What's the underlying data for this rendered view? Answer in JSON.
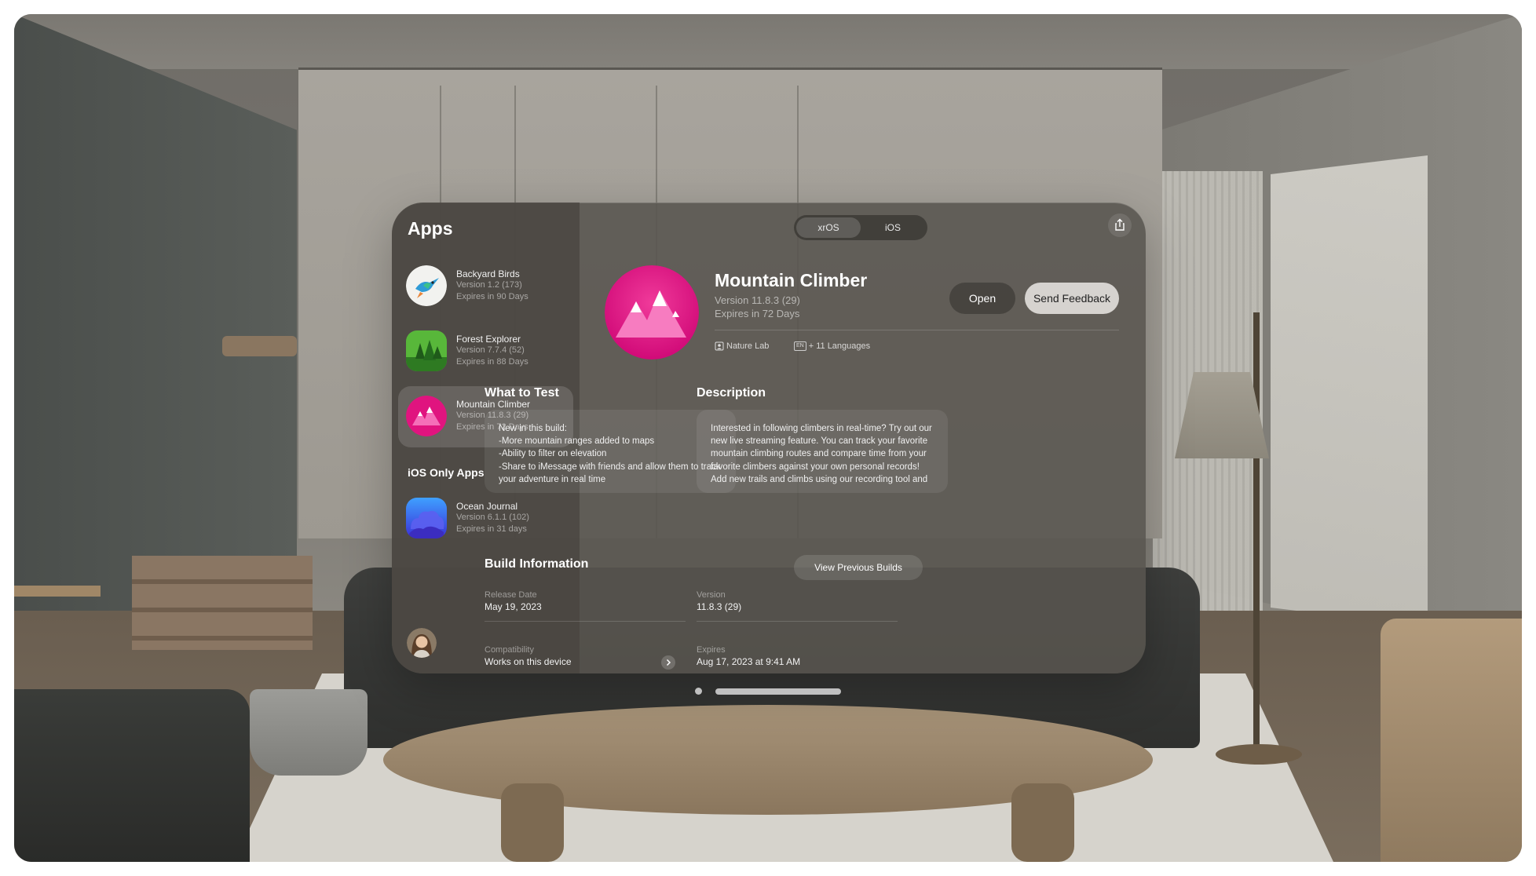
{
  "sidebar": {
    "title": "Apps",
    "apps": [
      {
        "name": "Backyard Birds",
        "version": "Version 1.2 (173)",
        "expires": "Expires in 90 Days",
        "icon": "hummingbird-icon"
      },
      {
        "name": "Forest Explorer",
        "version": "Version 7.7.4 (52)",
        "expires": "Expires in 88 Days",
        "icon": "forest-icon"
      },
      {
        "name": "Mountain Climber",
        "version": "Version 11.8.3 (29)",
        "expires": "Expires in 72 Days",
        "icon": "mountain-icon",
        "selected": true
      }
    ],
    "ios_section_title": "iOS Only Apps",
    "ios_apps": [
      {
        "name": "Ocean Journal",
        "version": "Version 6.1.1 (102)",
        "expires": "Expires in 31 days",
        "icon": "cloud-icon"
      }
    ]
  },
  "platform_toggle": {
    "options": [
      "xrOS",
      "iOS"
    ],
    "selected": "xrOS"
  },
  "detail": {
    "title": "Mountain Climber",
    "version": "Version 11.8.3 (29)",
    "expires": "Expires in 72 Days",
    "open_label": "Open",
    "feedback_label": "Send Feedback",
    "developer": "Nature Lab",
    "languages": "+ 11 Languages",
    "language_badge": "EN",
    "what_to_test_title": "What to Test",
    "what_to_test_text": "New in this build:\n-More mountain ranges added to maps\n-Ability to filter on elevation\n-Share to iMessage with friends and allow them to track your adventure in real time\n-More categories of types of trails and featurings",
    "description_title": "Description",
    "description_text": "Interested in following climbers in real-time? Try out our new live streaming feature. You can track your favorite mountain climbing routes and compare time from your favorite climbers against your own personal records! Add new trails and climbs using our recording tool and share with",
    "build_info_title": "Build Information",
    "view_previous_label": "View Previous Builds",
    "build_info": {
      "release_date_label": "Release Date",
      "release_date": "May 19, 2023",
      "version_label": "Version",
      "version": "11.8.3 (29)",
      "compatibility_label": "Compatibility",
      "compatibility": "Works on this device",
      "expires_label": "Expires",
      "expires": "Aug 17, 2023 at 9:41 AM"
    }
  },
  "colors": {
    "accent_pink": "#e0147f",
    "forest_green": "#3f9a2e",
    "ocean_blue": "#3a4fe0"
  }
}
